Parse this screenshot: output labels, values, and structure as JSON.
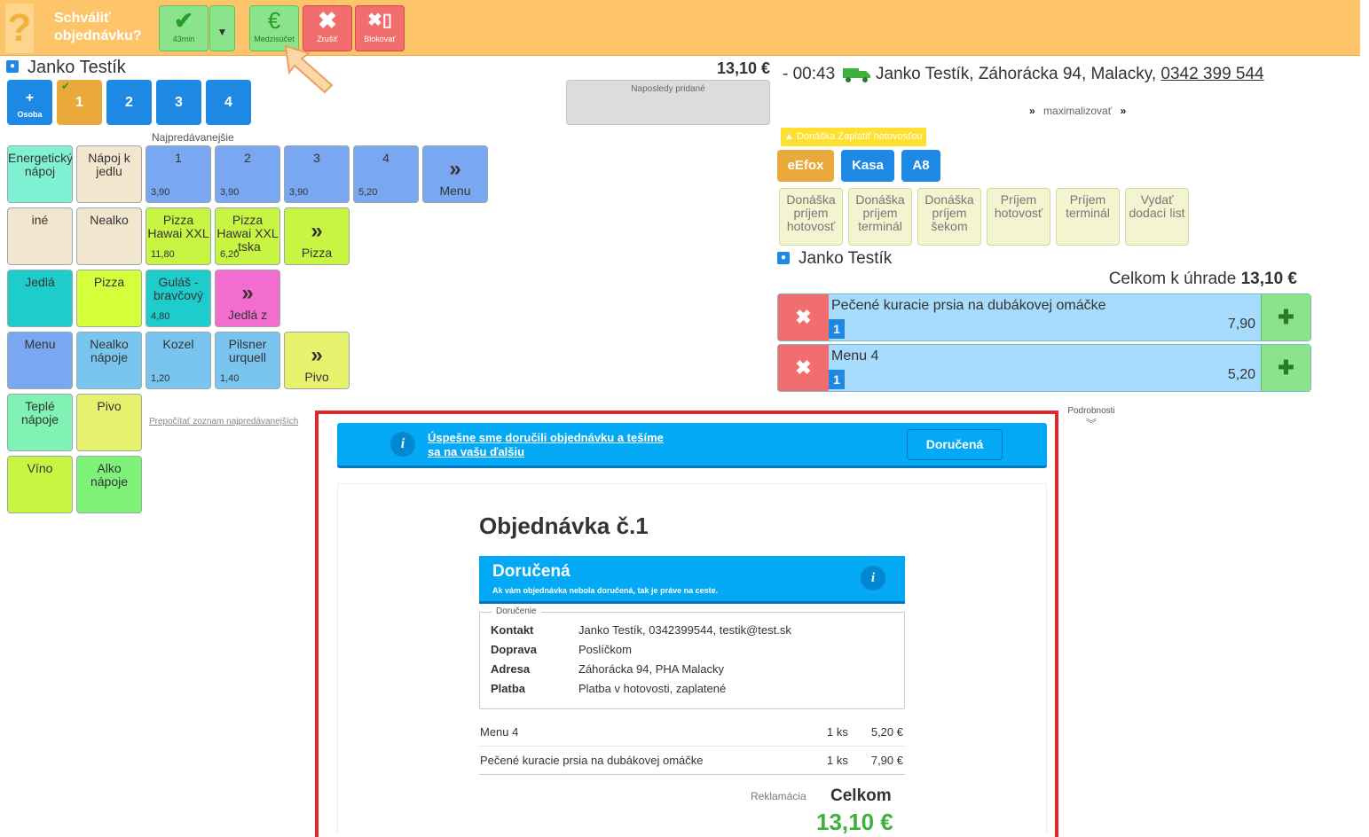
{
  "topbar": {
    "question_icon": "?",
    "title": "Schváliť objednávku?",
    "approve_label": "43min",
    "subtotal_label": "Medzisúčet",
    "cancel_label": "Zrušiť",
    "block_label": "Blokovať",
    "euro_icon": "€"
  },
  "customer": {
    "name": "Janko Testík",
    "total": "13,10 €",
    "last_added": "Naposledy pridané"
  },
  "seats": {
    "add_label": "Osoba",
    "add_icon": "+",
    "items": [
      "1",
      "2",
      "3",
      "4"
    ]
  },
  "bestsellers_label": "Najpredávanejšie",
  "recalc_link": "Prepočítať zoznam najpredávanejších",
  "tiles": [
    {
      "label": "Energetický nápoj",
      "color": "#7ff2d4"
    },
    {
      "label": "Nápoj k jedlu",
      "color": "#f3e6cf"
    },
    {
      "label": "1",
      "price": "3,90",
      "color": "#7aa8f0"
    },
    {
      "label": "2",
      "price": "3,90",
      "color": "#7aa8f0"
    },
    {
      "label": "3",
      "price": "3,90",
      "color": "#7aa8f0"
    },
    {
      "label": "4",
      "price": "5,20",
      "color": "#7aa8f0"
    },
    {
      "label": "Menu",
      "chev": true,
      "color": "#7aa8f0"
    },
    {
      "label": "iné",
      "color": "#f3e6cf"
    },
    {
      "label": "Nealko",
      "color": "#f3e6cf"
    },
    {
      "label": "Pizza Hawai XXL",
      "price": "11,80",
      "color": "#c8f542"
    },
    {
      "label": "Pizza Hawai XXL ,tska",
      "price": "6,20",
      "color": "#c8f542"
    },
    {
      "label": "Pizza",
      "chev": true,
      "color": "#c8f542"
    },
    {
      "label": "Jedlá",
      "color": "#1fcccc"
    },
    {
      "label": "Pizza",
      "color": "#d4ff3a"
    },
    {
      "label": "Guláš - bravčový",
      "price": "4,80",
      "color": "#1fcccc"
    },
    {
      "label": "Jedlá z",
      "chev": true,
      "color": "#f26dcf"
    },
    {
      "label": "Menu",
      "color": "#7aa8f0"
    },
    {
      "label": "Nealko nápoje",
      "color": "#7ac4f0"
    },
    {
      "label": "Kozel",
      "price": "1,20",
      "color": "#7ac4f0"
    },
    {
      "label": "Pilsner urquell",
      "price": "1,40",
      "color": "#7ac4f0"
    },
    {
      "label": "Pivo",
      "chev": true,
      "color": "#e6f26d"
    },
    {
      "label": "Teplé nápoje",
      "color": "#7ff2b4"
    },
    {
      "label": "Pivo",
      "color": "#e6f26d"
    },
    {
      "label": "Víno",
      "color": "#c8f542"
    },
    {
      "label": "Alko nápoje",
      "color": "#7ff27a"
    }
  ],
  "delivery": {
    "time": "- 00:43",
    "address_line": "Janko Testík, Záhorácka 94, Malacky,",
    "phone": "0342 399 544",
    "maximize": "maximalizovať",
    "pay_badge": "Donáška Zaplatiť hotovosťou"
  },
  "channels": [
    "eEfox",
    "Kasa",
    "A8"
  ],
  "cash_buttons": [
    "Donáška príjem hotovosť",
    "Donáška príjem terminál",
    "Donáška príjem šekom",
    "Príjem hotovosť",
    "Príjem terminál",
    "Vydať dodací list"
  ],
  "order_panel": {
    "customer": "Janko Testík",
    "total_label": "Celkom k úhrade",
    "total": "13,10 €",
    "items": [
      {
        "name": "Pečené kuracie prsia na dubákovej omáčke",
        "qty": "1",
        "price": "7,90"
      },
      {
        "name": "Menu 4",
        "qty": "1",
        "price": "5,20"
      }
    ],
    "details": "Podrobnosti"
  },
  "notice": {
    "icon": "i",
    "text": "Úspešne sme doručili objednávku a tešíme sa na vašu ďalšiu",
    "button": "Doručená"
  },
  "order": {
    "title": "Objednávka č.1",
    "status": "Doručená",
    "status_sub": "Ak vám objednávka nebola doručená, tak je práve na ceste.",
    "section": "Doručenie",
    "rows": [
      {
        "k": "Kontakt",
        "v": "Janko Testík, 0342399544, testik@test.sk"
      },
      {
        "k": "Doprava",
        "v": "Poslíčkom"
      },
      {
        "k": "Adresa",
        "v": "Záhorácka 94, PHA Malacky"
      },
      {
        "k": "Platba",
        "v": "Platba v hotovosti, zaplatené"
      }
    ],
    "lines": [
      {
        "name": "Menu 4",
        "qty": "1 ks",
        "price": "5,20 €"
      },
      {
        "name": "Pečené kuracie prsia na dubákovej omáčke",
        "qty": "1 ks",
        "price": "7,90 €"
      }
    ],
    "complaint": "Reklamácia",
    "total_label": "Celkom",
    "total": "13,10 €"
  }
}
